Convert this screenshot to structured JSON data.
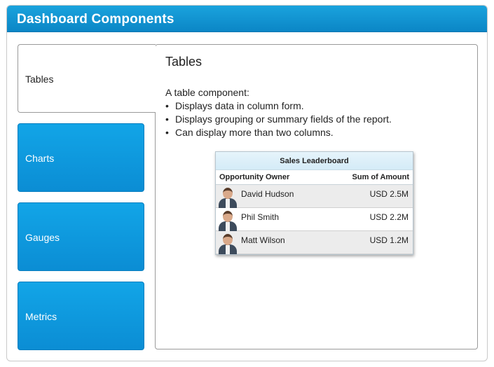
{
  "header": {
    "title": "Dashboard Components"
  },
  "tabs": [
    {
      "label": "Tables",
      "active": true
    },
    {
      "label": "Charts",
      "active": false
    },
    {
      "label": "Gauges",
      "active": false
    },
    {
      "label": "Metrics",
      "active": false
    }
  ],
  "content": {
    "title": "Tables",
    "intro": "A table component:",
    "bullets": [
      "Displays data in column form.",
      "Displays grouping or summary fields of the report.",
      "Can display more than two columns."
    ]
  },
  "leaderboard": {
    "title": "Sales Leaderboard",
    "columns": [
      "Opportunity Owner",
      "Sum of Amount"
    ],
    "rows": [
      {
        "owner": "David Hudson",
        "amount": "USD 2.5M"
      },
      {
        "owner": "Phil Smith",
        "amount": "USD 2.2M"
      },
      {
        "owner": "Matt Wilson",
        "amount": "USD 1.2M"
      }
    ]
  },
  "colors": {
    "header_blue": "#0b86c6",
    "tab_blue": "#0b8dd4"
  }
}
